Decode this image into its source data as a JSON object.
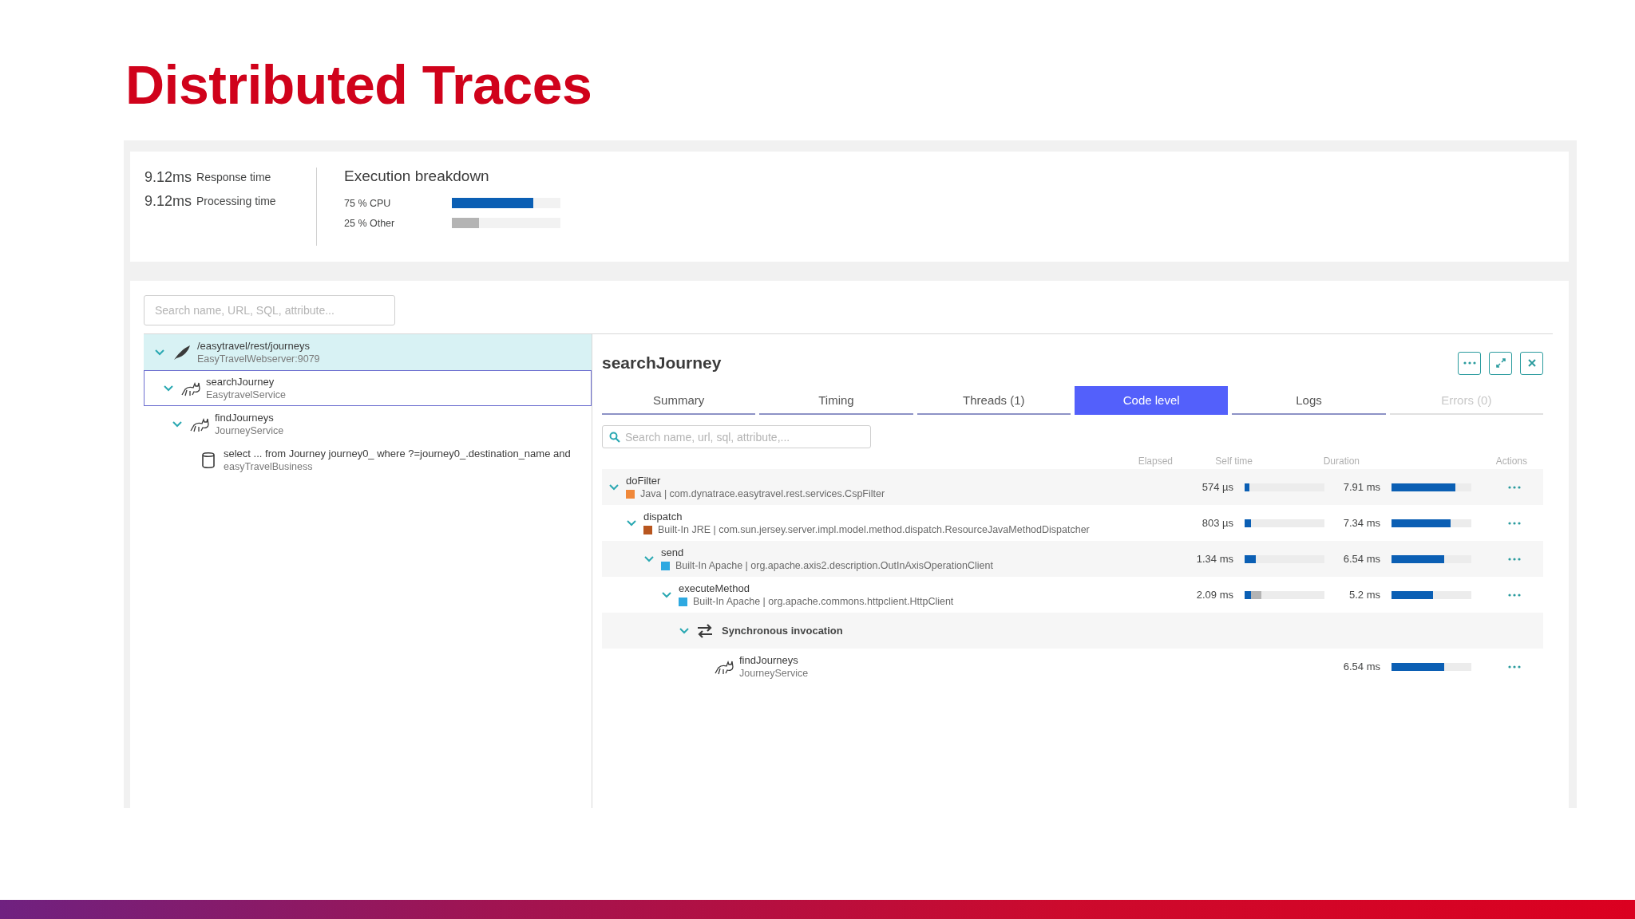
{
  "slide_title": "Distributed Traces",
  "summary": {
    "metrics": [
      {
        "value": "9.12ms",
        "label": "Response time"
      },
      {
        "value": "9.12ms",
        "label": "Processing time"
      }
    ],
    "breakdown": {
      "title": "Execution breakdown",
      "items": [
        {
          "label": "75 % CPU",
          "kind": "cpu",
          "level": 0.75
        },
        {
          "label": "25 % Other",
          "kind": "other",
          "level": 0.25
        }
      ]
    }
  },
  "tree": {
    "search": {
      "placeholder": "Search name, URL, SQL, attribute..."
    },
    "nodes": [
      {
        "name": "/easytravel/rest/journeys",
        "sub": "EasyTravelWebserver:9079",
        "kind": "feather",
        "expanded": true,
        "highlighted": true,
        "selected": false,
        "children": [
          {
            "name": "searchJourney",
            "sub": "EasytravelService",
            "kind": "service",
            "expanded": true,
            "highlighted": false,
            "selected": true,
            "children": [
              {
                "name": "findJourneys",
                "sub": "JourneyService",
                "kind": "service",
                "expanded": true,
                "highlighted": false,
                "selected": false,
                "children": [
                  {
                    "name": "select ... from Journey journey0_ where ?=journey0_.destination_name and",
                    "sub": "easyTravelBusiness",
                    "kind": "database",
                    "highlighted": false,
                    "selected": false
                  }
                ]
              }
            ]
          }
        ]
      }
    ]
  },
  "details": {
    "title": "searchJourney",
    "tabs": [
      {
        "label": "Summary",
        "selected": false,
        "disabled": false
      },
      {
        "label": "Timing",
        "selected": false,
        "disabled": false
      },
      {
        "label": "Threads (1)",
        "selected": false,
        "disabled": false
      },
      {
        "label": "Code level",
        "selected": true,
        "disabled": false
      },
      {
        "label": "Logs",
        "selected": false,
        "disabled": false
      },
      {
        "label": "Errors (0)",
        "selected": false,
        "disabled": true
      }
    ],
    "search": {
      "placeholder": "Search name, url, sql, attribute,..."
    },
    "columns": [
      "Elapsed",
      "Self time",
      "Duration",
      "Actions"
    ],
    "rows": [
      {
        "kind": "method",
        "name": "doFilter",
        "detail": "Java | com.dynatrace.easytravel.rest.services.CspFilter",
        "color": "#f0883a",
        "self_time": "574 µs",
        "self_bar": [
          {
            "kind": "cpu",
            "level": 0.06
          }
        ],
        "duration": "7.91 ms",
        "duration_bar": {
          "level": 0.8
        },
        "children": [
          {
            "kind": "method",
            "name": "dispatch",
            "detail": "Built-In JRE | com.sun.jersey.server.impl.model.method.dispatch.ResourceJavaMethodDispatcher",
            "color": "#b8561f",
            "self_time": "803 µs",
            "self_bar": [
              {
                "kind": "cpu",
                "level": 0.08
              }
            ],
            "duration": "7.34 ms",
            "duration_bar": {
              "level": 0.74
            },
            "children": [
              {
                "kind": "method",
                "name": "send",
                "detail": "Built-In Apache | org.apache.axis2.description.OutInAxisOperationClient",
                "color": "#2ea9e1",
                "self_time": "1.34 ms",
                "self_bar": [
                  {
                    "kind": "cpu",
                    "level": 0.14
                  }
                ],
                "duration": "6.54 ms",
                "duration_bar": {
                  "level": 0.66
                },
                "children": [
                  {
                    "kind": "method",
                    "name": "executeMethod",
                    "detail": "Built-In Apache | org.apache.commons.httpclient.HttpClient",
                    "color": "#2ea9e1",
                    "self_time": "2.09 ms",
                    "self_bar": [
                      {
                        "kind": "cpu",
                        "level": 0.08
                      },
                      {
                        "kind": "other",
                        "level": 0.13
                      }
                    ],
                    "duration": "5.2 ms",
                    "duration_bar": {
                      "level": 0.52
                    },
                    "children": [
                      {
                        "kind": "invocation",
                        "name": "Synchronous invocation",
                        "children": [
                          {
                            "kind": "service",
                            "name": "findJourneys",
                            "detail": "JourneyService",
                            "duration": "6.54 ms",
                            "duration_bar": {
                              "level": 0.66
                            }
                          }
                        ]
                      }
                    ]
                  }
                ]
              }
            ]
          }
        ]
      }
    ]
  }
}
